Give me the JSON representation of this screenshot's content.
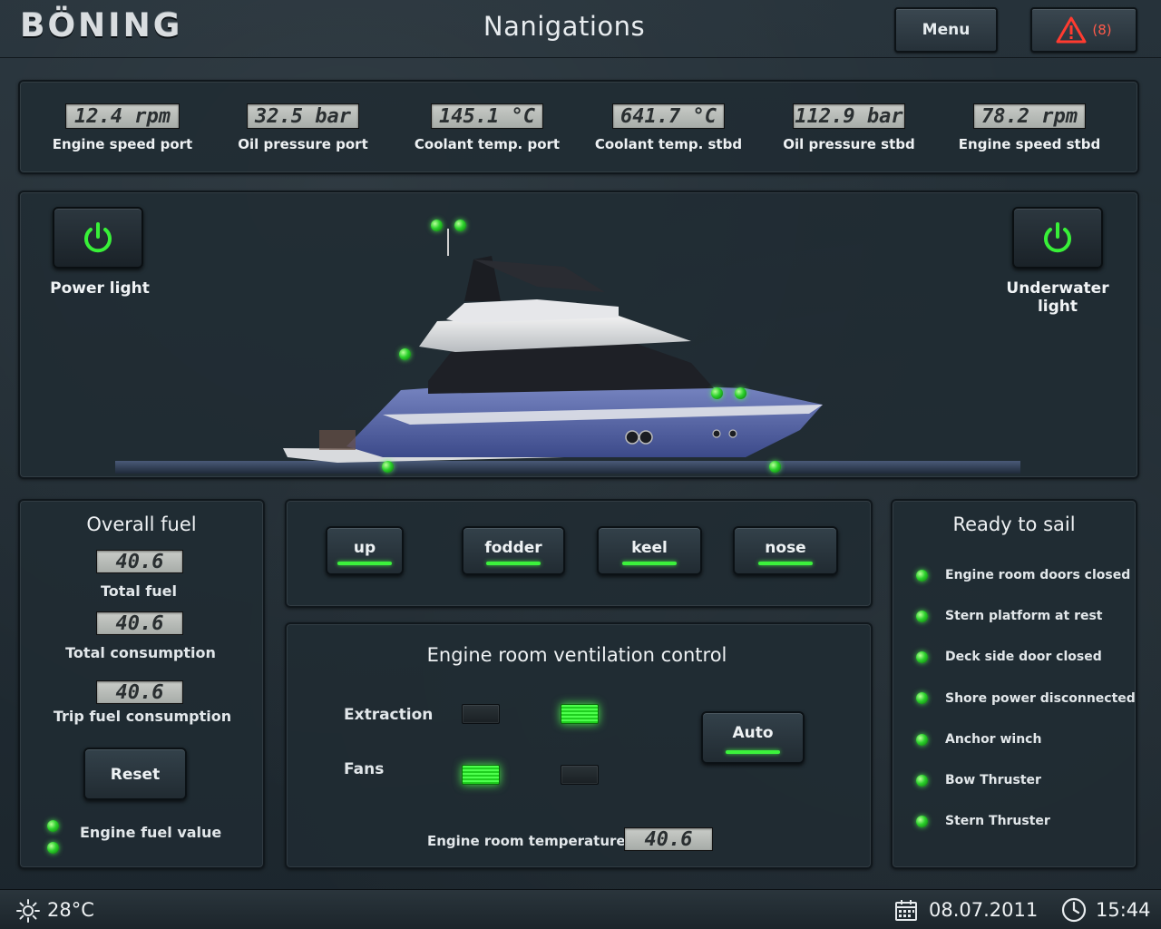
{
  "header": {
    "logo": "BÖNING",
    "title": "Nanigations",
    "menu_label": "Menu",
    "alert_count": "(8)"
  },
  "gauges": [
    {
      "value": "12.4  rpm",
      "label": "Engine speed port"
    },
    {
      "value": "32.5  bar",
      "label": "Oil pressure port"
    },
    {
      "value": "145.1  °C",
      "label": "Coolant temp. port"
    },
    {
      "value": "641.7  °C",
      "label": "Coolant temp. stbd"
    },
    {
      "value": "112.9  bar",
      "label": "Oil pressure stbd"
    },
    {
      "value": "78.2  rpm",
      "label": "Engine speed stbd"
    }
  ],
  "lights": {
    "power_light_label": "Power light",
    "underwater_light_label": "Underwater light"
  },
  "fuel": {
    "title": "Overall fuel",
    "total_fuel_value": "40.6",
    "total_fuel_label": "Total fuel",
    "total_consumption_value": "40.6",
    "total_consumption_label": "Total consumption",
    "trip_value": "40.6",
    "trip_label": "Trip fuel consumption",
    "reset_label": "Reset",
    "engine_fuel_label": "Engine fuel value"
  },
  "controls": {
    "buttons": [
      "up",
      "fodder",
      "keel",
      "nose"
    ]
  },
  "ventilation": {
    "title": "Engine room ventilation control",
    "extraction_label": "Extraction",
    "fans_label": "Fans",
    "auto_label": "Auto",
    "temp_label": "Engine room temperature",
    "temp_value": "40.6"
  },
  "ready": {
    "title": "Ready to sail",
    "items": [
      "Engine room doors closed",
      "Stern platform at rest",
      "Deck side door closed",
      "Shore power disconnected",
      "Anchor winch",
      "Bow Thruster",
      "Stern Thruster"
    ]
  },
  "footer": {
    "temperature": "28°C",
    "date": "08.07.2011",
    "time": "15:44"
  },
  "colors": {
    "led_green": "#2bd12b",
    "alert_red": "#ff3b30",
    "lcd_bg": "#b7bbb7"
  }
}
